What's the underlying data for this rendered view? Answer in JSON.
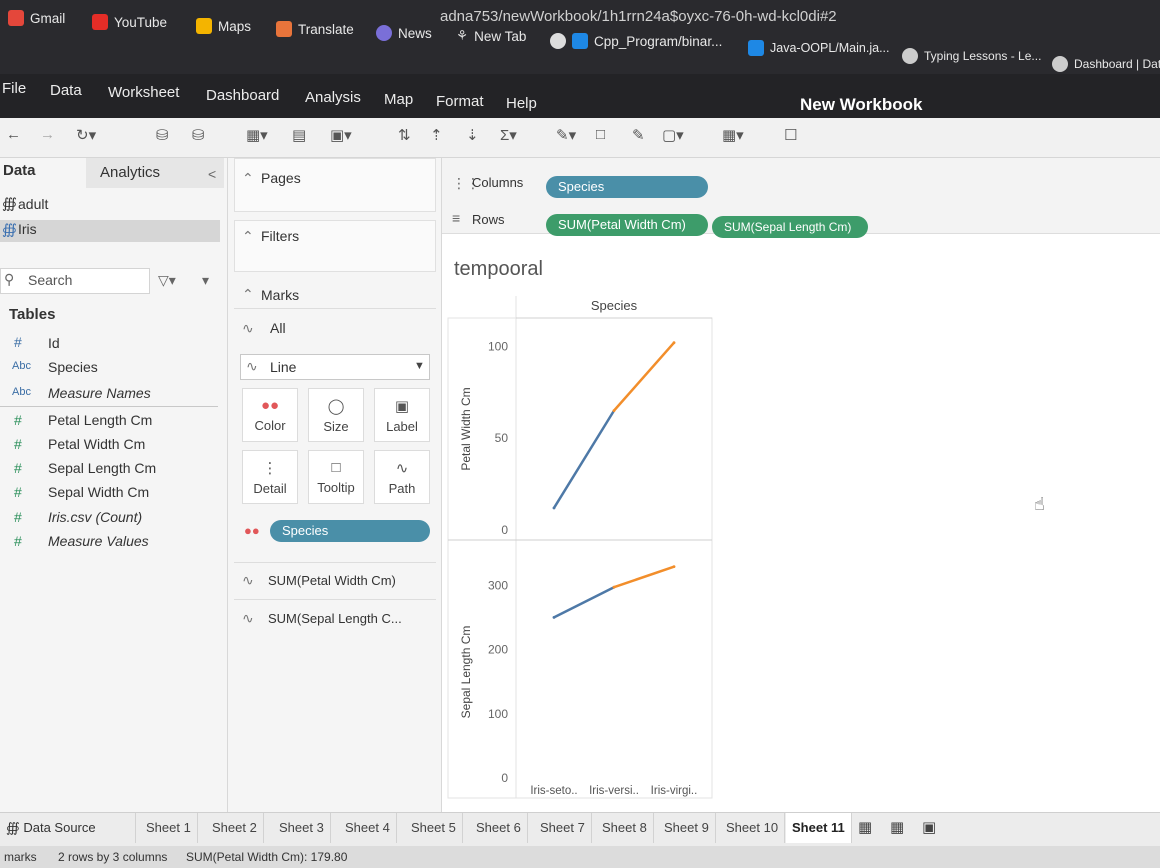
{
  "browser": {
    "url_fragment": "adna753/newWorkbook/1h1rrn24a$oyxc-76-0h-wd-kcl0di#2",
    "bookmarks": [
      "Gmail",
      "YouTube",
      "Maps",
      "Translate",
      "News",
      "New Tab",
      "Cpp_Program/binar...",
      "Java-OOPL/Main.ja...",
      "Typing Lessons - Le...",
      "Dashboard | Data"
    ]
  },
  "menu": {
    "items": [
      "File",
      "Data",
      "Worksheet",
      "Dashboard",
      "Analysis",
      "Map",
      "Format",
      "Help"
    ],
    "workbook_title": "New Workbook"
  },
  "left": {
    "tab_data": "Data",
    "tab_analytics": "Analytics",
    "collapse": "<",
    "datasources": [
      "adult",
      "Iris"
    ],
    "search_placeholder": "Search",
    "tables_header": "Tables",
    "fields": [
      {
        "type": "#",
        "name": "Id"
      },
      {
        "type": "Abc",
        "name": "Species"
      },
      {
        "type": "Abc",
        "name": "Measure Names"
      },
      {
        "type": "#",
        "name": "Petal Length Cm"
      },
      {
        "type": "#",
        "name": "Petal Width Cm"
      },
      {
        "type": "#",
        "name": "Sepal Length Cm"
      },
      {
        "type": "#",
        "name": "Sepal Width Cm"
      },
      {
        "type": "#",
        "name": "Iris.csv (Count)"
      },
      {
        "type": "#",
        "name": "Measure Values"
      }
    ]
  },
  "cards": {
    "pages": "Pages",
    "filters": "Filters",
    "marks": "Marks",
    "marks_all": "All",
    "mark_type": "Line",
    "mark_buttons": [
      "Color",
      "Size",
      "Label",
      "Detail",
      "Tooltip",
      "Path"
    ],
    "color_pill": "Species",
    "measures": [
      "SUM(Petal Width Cm)",
      "SUM(Sepal Length C..."
    ]
  },
  "shelves": {
    "columns_label": "Columns",
    "rows_label": "Rows",
    "columns_pills": [
      "Species"
    ],
    "rows_pills": [
      "SUM(Petal Width Cm)",
      "SUM(Sepal Length Cm)"
    ]
  },
  "sheet_title": "tempooral",
  "chart_data": {
    "type": "line",
    "column_header": "Species",
    "categories": [
      "Iris-seto..",
      "Iris-versi..",
      "Iris-virgi.."
    ],
    "panes": [
      {
        "ylabel": "Petal Width Cm",
        "yticks": [
          0,
          50,
          100
        ],
        "ylim": [
          0,
          110
        ],
        "values": [
          12,
          65,
          102
        ],
        "segment_colors": [
          "#4e79a7",
          "#f28e2b"
        ]
      },
      {
        "ylabel": "Sepal Length Cm",
        "yticks": [
          0,
          100,
          200,
          300
        ],
        "ylim": [
          0,
          330
        ],
        "values": [
          250,
          297,
          329
        ],
        "segment_colors": [
          "#4e79a7",
          "#f28e2b"
        ]
      }
    ]
  },
  "tabs": {
    "data_source": "Data Source",
    "sheets": [
      "Sheet 1",
      "Sheet 2",
      "Sheet 3",
      "Sheet 4",
      "Sheet 5",
      "Sheet 6",
      "Sheet 7",
      "Sheet 8",
      "Sheet 9",
      "Sheet 10",
      "Sheet 11"
    ],
    "active": "Sheet 11"
  },
  "status": {
    "marks": "marks",
    "rows_cols": "2 rows by 3 columns",
    "sum": "SUM(Petal Width Cm): 179.80"
  }
}
